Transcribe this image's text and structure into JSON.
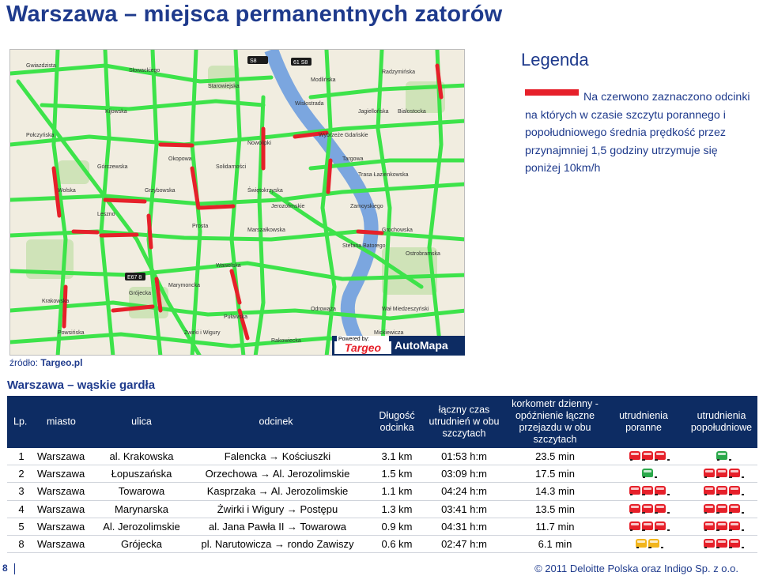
{
  "page": {
    "title": "Warszawa – miejsca permanentnych zatorów",
    "page_number": "8",
    "copyright": "© 2011 Deloitte Polska oraz Indigo Sp. z o.o."
  },
  "legend": {
    "title": "Legenda",
    "text": "Na czerwono zaznaczono odcinki na których w czasie szczytu porannego i popołudniowego średnia prędkość przez przynajmniej 1,5 godziny utrzymuje się poniżej 10km/h",
    "swatch_color": "#e6202a"
  },
  "map": {
    "powered_by": "Powered by:",
    "logo_targeo": "Targeo",
    "logo_automapa": "AutoMapa",
    "street_labels": [
      "Gwiazdzista",
      "Słowackiego",
      "Starowiejska",
      "Połczyńska",
      "Wolska",
      "Górczewska",
      "Grzybowska",
      "Prosta",
      "Leszno",
      "Okopowa",
      "Solidarności",
      "Marszałkowska",
      "Świętokrzyska",
      "Jerozolimskie",
      "Wawelska",
      "Grójecka",
      "Puławska",
      "Wisłostrada",
      "Wybrzeże Gdańskie",
      "Trasa Łazienkowska",
      "Rakowiecka",
      "Odrowąża",
      "Radzymińska",
      "Targowa",
      "Zamoyskiego",
      "Grochowska",
      "Ostrobramska",
      "Wał Miedzeszyński",
      "Żwirki i Wigury",
      "Krakowska",
      "Stefana Batorego",
      "Modlińska",
      "Jagiellońska",
      "Bialostocka",
      "Kijowska",
      "Marymoncka",
      "Nowolipki",
      "Mickiewicza",
      "Powsińska"
    ],
    "route_badges": [
      "S8",
      "E67 8",
      "61 S8"
    ],
    "colors": {
      "congested": "#e6202a",
      "free_flow": "#3de34a",
      "water": "#7ba6df",
      "background": "#f1ede0"
    }
  },
  "source": {
    "prefix": "źródło: ",
    "name": "Targeo.pl"
  },
  "subtitle": "Warszawa – wąskie gardła",
  "table": {
    "headers": {
      "lp": "Lp.",
      "miasto": "miasto",
      "ulica": "ulica",
      "odcinek": "odcinek",
      "dlugosc": "Długość odcinka",
      "czas": "łączny czas utrudnień w obu szczytach",
      "korkometr": "korkometr dzienny - opóźnienie łączne przejazdu w obu szczytach",
      "ranne": "utrudnienia poranne",
      "popoludniowe": "utrudnienia popołudniowe"
    },
    "rows": [
      {
        "lp": "1",
        "miasto": "Warszawa",
        "ulica": "al. Krakowska",
        "odcinek": "Falencka → Kościuszki",
        "dlugosc": "3.1 km",
        "czas": "01:53 h:m",
        "korkometr": "23.5 min",
        "ranne": {
          "count": 3,
          "level": "red"
        },
        "popoludniowe": {
          "count": 1,
          "level": "green"
        }
      },
      {
        "lp": "2",
        "miasto": "Warszawa",
        "ulica": "Łopuszańska",
        "odcinek": "Orzechowa → Al. Jerozolimskie",
        "dlugosc": "1.5 km",
        "czas": "03:09 h:m",
        "korkometr": "17.5 min",
        "ranne": {
          "count": 1,
          "level": "green"
        },
        "popoludniowe": {
          "count": 3,
          "level": "red"
        }
      },
      {
        "lp": "3",
        "miasto": "Warszawa",
        "ulica": "Towarowa",
        "odcinek": "Kasprzaka → Al. Jerozolimskie",
        "dlugosc": "1.1 km",
        "czas": "04:24 h:m",
        "korkometr": "14.3 min",
        "ranne": {
          "count": 3,
          "level": "red"
        },
        "popoludniowe": {
          "count": 3,
          "level": "red"
        }
      },
      {
        "lp": "4",
        "miasto": "Warszawa",
        "ulica": "Marynarska",
        "odcinek": "Żwirki i Wigury → Postępu",
        "dlugosc": "1.3 km",
        "czas": "03:41 h:m",
        "korkometr": "13.5 min",
        "ranne": {
          "count": 3,
          "level": "red"
        },
        "popoludniowe": {
          "count": 3,
          "level": "red"
        }
      },
      {
        "lp": "5",
        "miasto": "Warszawa",
        "ulica": "Al. Jerozolimskie",
        "odcinek": "al. Jana Pawła II → Towarowa",
        "dlugosc": "0.9 km",
        "czas": "04:31 h:m",
        "korkometr": "11.7 min",
        "ranne": {
          "count": 3,
          "level": "red"
        },
        "popoludniowe": {
          "count": 3,
          "level": "red"
        }
      },
      {
        "lp": "8",
        "miasto": "Warszawa",
        "ulica": "Grójecka",
        "odcinek": "pl. Narutowicza → rondo Zawiszy",
        "dlugosc": "0.6 km",
        "czas": "02:47 h:m",
        "korkometr": "6.1 min",
        "ranne": {
          "count": 2,
          "level": "yellow"
        },
        "popoludniowe": {
          "count": 3,
          "level": "red"
        }
      }
    ],
    "car_colors": {
      "red": "#e6202a",
      "green": "#2aa84a",
      "yellow": "#f2b51c"
    }
  }
}
